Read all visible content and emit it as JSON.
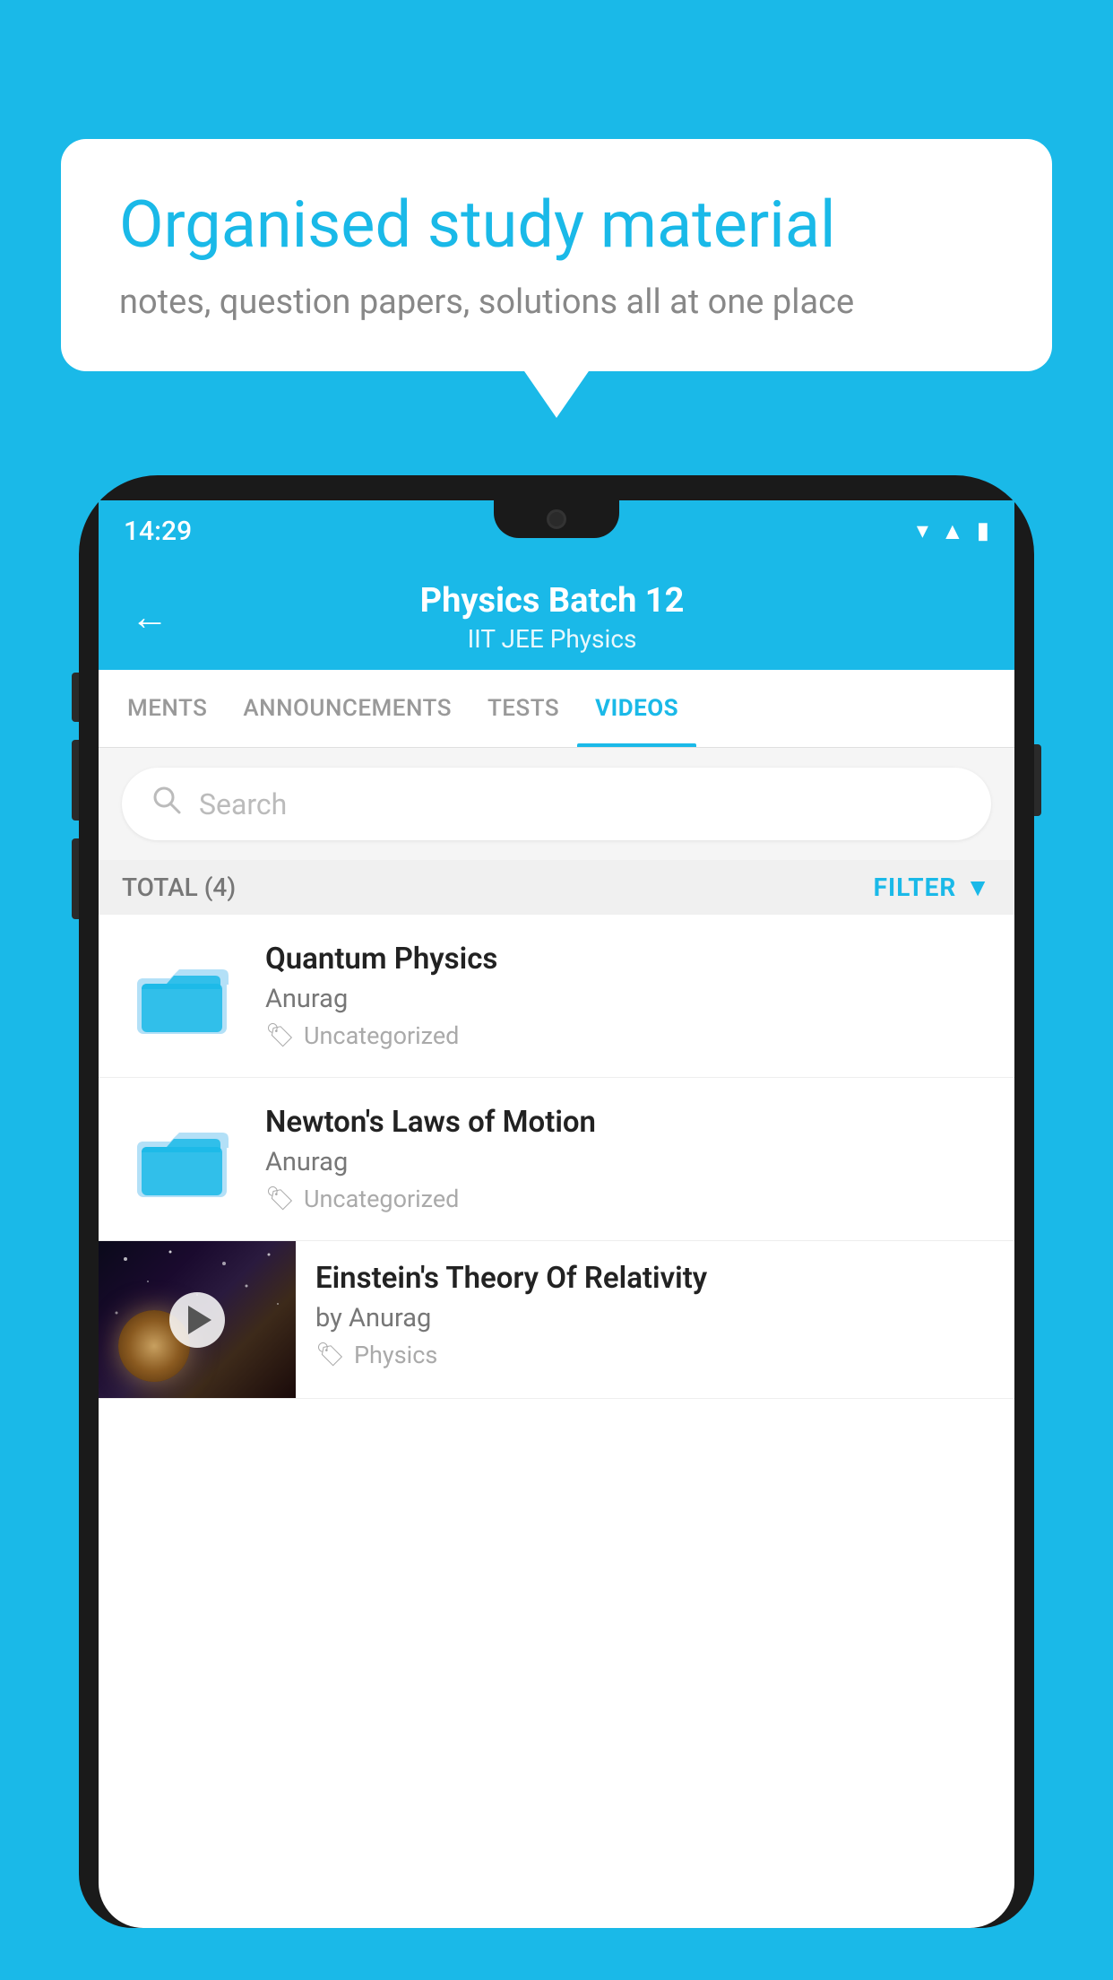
{
  "bubble": {
    "title": "Organised study material",
    "subtitle": "notes, question papers, solutions all at one place"
  },
  "phone": {
    "status": {
      "time": "14:29"
    },
    "header": {
      "title": "Physics Batch 12",
      "subtitle": "IIT JEE   Physics",
      "back_label": "←"
    },
    "tabs": [
      {
        "label": "MENTS",
        "active": false
      },
      {
        "label": "ANNOUNCEMENTS",
        "active": false
      },
      {
        "label": "TESTS",
        "active": false
      },
      {
        "label": "VIDEOS",
        "active": true
      }
    ],
    "search": {
      "placeholder": "Search"
    },
    "filter": {
      "total_label": "TOTAL (4)",
      "filter_label": "FILTER"
    },
    "videos": [
      {
        "id": 1,
        "title": "Quantum Physics",
        "author": "Anurag",
        "category": "Uncategorized",
        "type": "folder"
      },
      {
        "id": 2,
        "title": "Newton's Laws of Motion",
        "author": "Anurag",
        "category": "Uncategorized",
        "type": "folder"
      },
      {
        "id": 3,
        "title": "Einstein's Theory Of Relativity",
        "author": "by Anurag",
        "category": "Physics",
        "type": "video"
      }
    ]
  }
}
